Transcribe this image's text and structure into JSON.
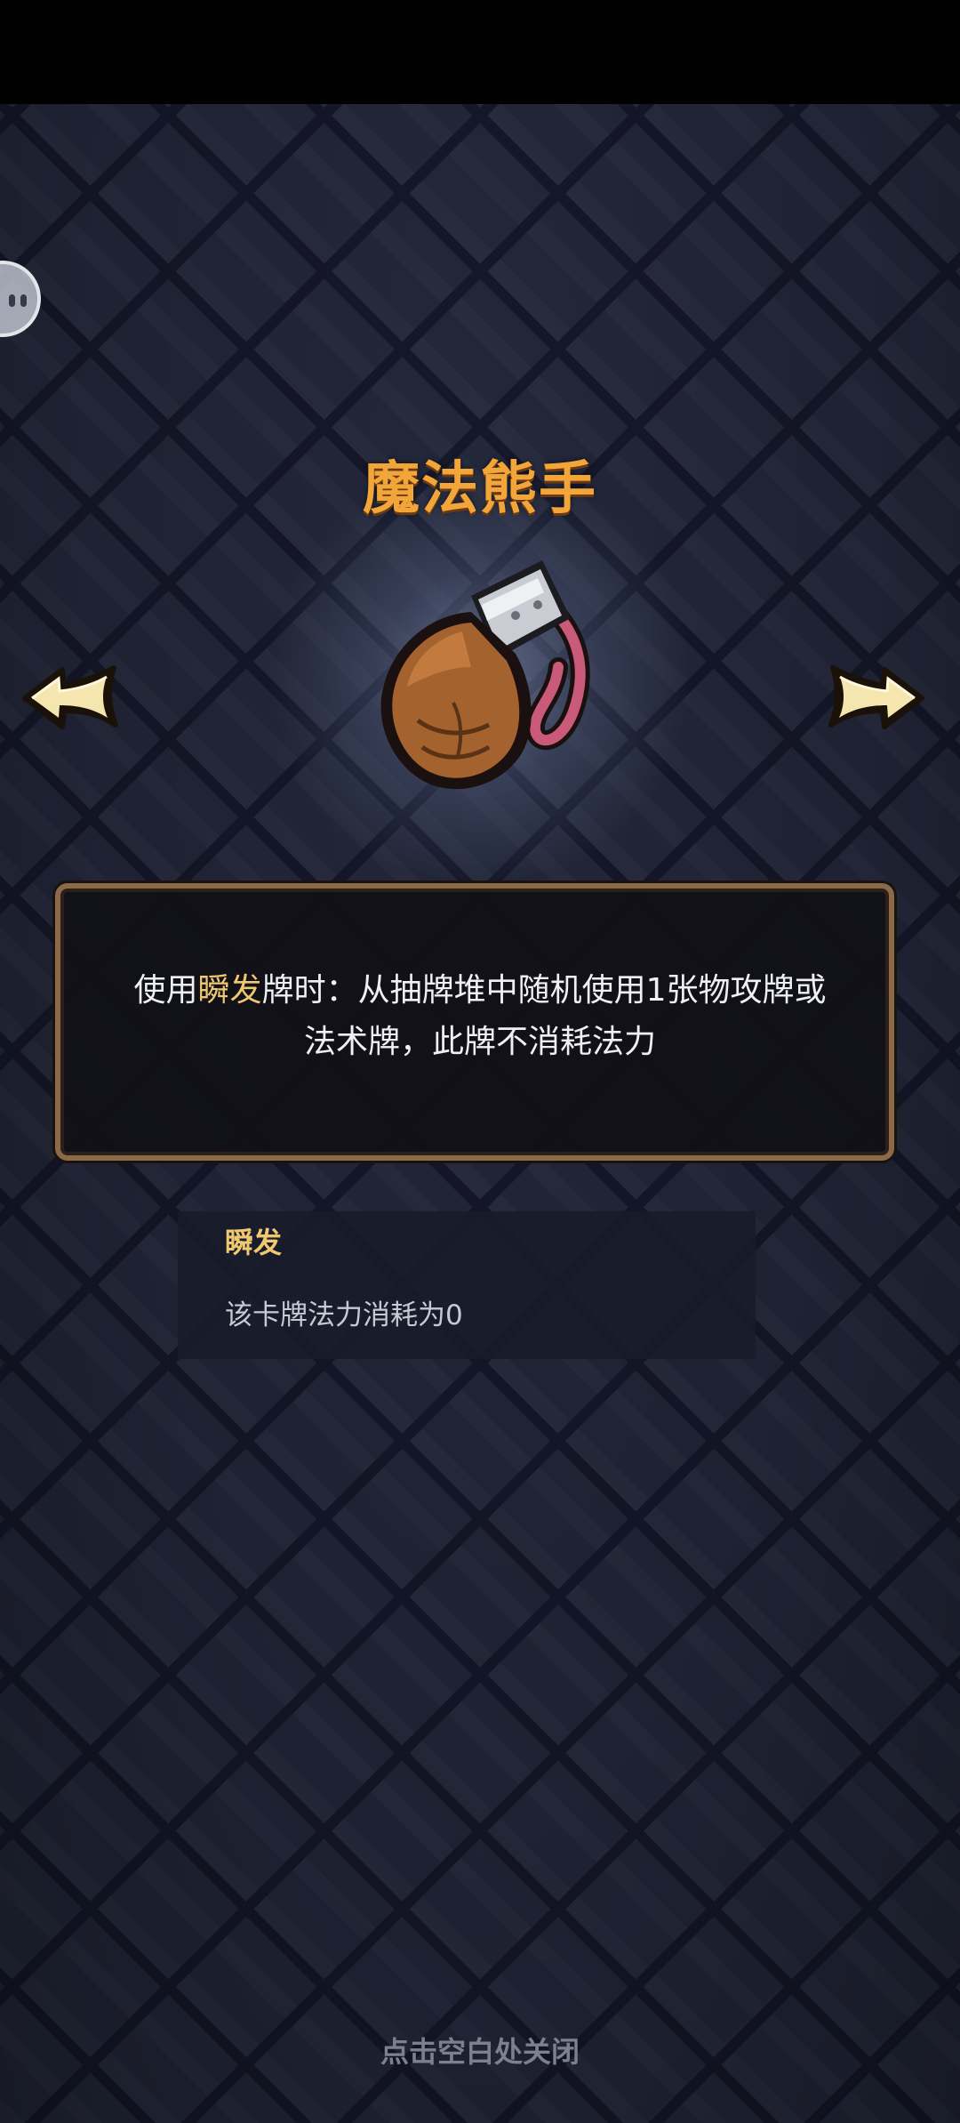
{
  "card": {
    "title": "魔法熊手",
    "art_icon": "bear-paw-icon"
  },
  "description": {
    "line1_prefix": "使用",
    "line1_keyword": "瞬发",
    "line1_suffix": "牌时：从抽牌堆中随机使用1张物攻牌或",
    "line2": "法术牌，此牌不消耗法力"
  },
  "keyword": {
    "title": "瞬发",
    "description": "该卡牌法力消耗为0"
  },
  "footer": {
    "close_hint": "点击空白处关闭"
  },
  "colors": {
    "title": "#f2a63a",
    "keyword_highlight": "#f0c870",
    "background": "#23273a",
    "panel_border": "#8b6a4a"
  },
  "icons": {
    "left_arrow": "arrow-left-icon",
    "right_arrow": "arrow-right-icon",
    "assistive_ball": "floating-ball-icon"
  }
}
